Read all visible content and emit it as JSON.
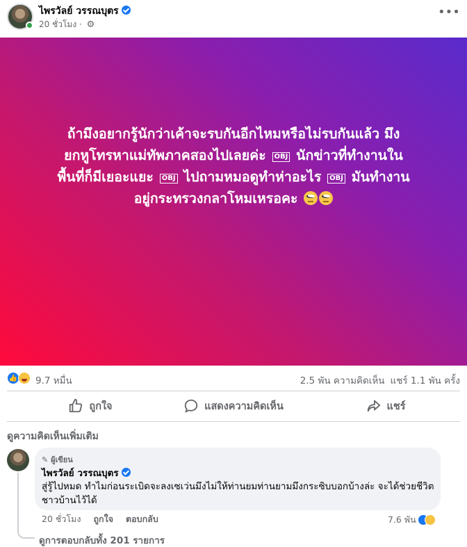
{
  "post": {
    "author": "ไพรวัลย์ วรรณบุตร",
    "timestamp": "20 ชั่วโมง",
    "separator": "·",
    "audience_icon": "gear-icon",
    "more_icon": "more-options-icon",
    "background_colors": [
      "#ff0a3b",
      "#c21870",
      "#8a1eae",
      "#5a2bcc"
    ],
    "text_line1": "ถ้ามึงอยากรู้นักว่าเค้าจะรบกันอีกไหมหรือไม่รบกันแล้ว มึง",
    "text_line2a": "ยกหูโทรหาแม่ทัพภาคสองไปเลยค่ะ",
    "text_line2b": "นักข่าวที่ทำงานใน",
    "text_line3a": "พื้นที่ก็มีเยอะแยะ",
    "text_line3b": "ไปถามหมอดูทำห่าอะไร",
    "text_line3c": "มันทำงาน",
    "text_line4": "อยู่กระทรวงกลาโหมเหรอคะ",
    "obj_placeholder": "OBJ",
    "emoji_icon": "eye-roll-emoji"
  },
  "stats": {
    "reactions_count": "9.7 หมื่น",
    "comments": "2.5 พัน ความคิดเห็น",
    "shares": "แชร์ 1.1 พัน ครั้ง"
  },
  "actions": {
    "like": "ถูกใจ",
    "comment": "แสดงความคิดเห็น",
    "share": "แชร์"
  },
  "comments_section": {
    "view_more": "ดูความคิดเห็นเพิ่มเติม",
    "comment": {
      "badge": "ผู้เขียน",
      "author": "ไพรวัลย์ วรรณบุตร",
      "text": "สู่รู้ไปหมด ทำไมก่อนระเบิดจะลงเซเว่นมึงไม่ให้ท่านยมท่านยามมึงกระซิบบอกบ้างล่ะ จะได้ช่วยชีวิตชาวบ้านไว้ได้",
      "time": "20 ชั่วโมง",
      "like": "ถูกใจ",
      "reply": "ตอบกลับ",
      "reaction_count": "7.6 พัน"
    },
    "view_replies": "ดูการตอบกลับทั้ง 201 รายการ"
  },
  "colors": {
    "facebook_blue": "#1877f2",
    "secondary_text": "#65676b",
    "bubble_bg": "#f0f2f5"
  }
}
